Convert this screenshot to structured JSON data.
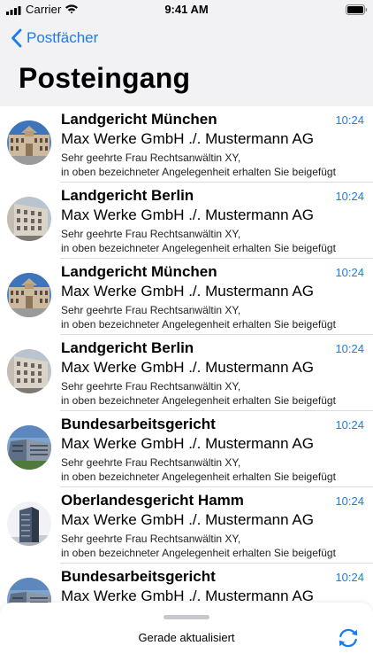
{
  "status_bar": {
    "carrier": "Carrier",
    "time": "9:41 AM"
  },
  "nav": {
    "back_label": "Postfächer",
    "title": "Posteingang"
  },
  "colors": {
    "accent": "#1a7cf0",
    "header_background": "#f2f2f4",
    "separator": "#dcdcde"
  },
  "mails": [
    {
      "sender": "Landgericht München",
      "time": "10:24",
      "subject": "Max Werke GmbH ./. Mustermann AG",
      "preview_line1": "Sehr geehrte Frau Rechtsanwältin XY,",
      "preview_line2": "in oben bezeichneter Angelegenheit erhalten Sie beigefügt",
      "avatar_icon": "palace-building-photo"
    },
    {
      "sender": "Landgericht Berlin",
      "time": "10:24",
      "subject": "Max Werke GmbH ./. Mustermann AG",
      "preview_line1": "Sehr geehrte Frau Rechtsanwältin XY,",
      "preview_line2": "in oben bezeichneter Angelegenheit erhalten Sie beigefügt",
      "avatar_icon": "courthouse-facade-photo"
    },
    {
      "sender": "Landgericht München",
      "time": "10:24",
      "subject": "Max Werke GmbH ./. Mustermann AG",
      "preview_line1": "Sehr geehrte Frau Rechtsanwältin XY,",
      "preview_line2": "in oben bezeichneter Angelegenheit erhalten Sie beigefügt",
      "avatar_icon": "palace-building-photo"
    },
    {
      "sender": "Landgericht Berlin",
      "time": "10:24",
      "subject": "Max Werke GmbH ./. Mustermann AG",
      "preview_line1": "Sehr geehrte Frau Rechtsanwältin XY,",
      "preview_line2": "in oben bezeichneter Angelegenheit erhalten Sie beigefügt",
      "avatar_icon": "courthouse-facade-photo"
    },
    {
      "sender": "Bundesarbeitsgericht",
      "time": "10:24",
      "subject": "Max Werke GmbH ./. Mustermann AG",
      "preview_line1": "Sehr geehrte Frau Rechtsanwältin XY,",
      "preview_line2": "in oben bezeichneter Angelegenheit erhalten Sie beigefügt",
      "avatar_icon": "modern-building-photo"
    },
    {
      "sender": "Oberlandesgericht Hamm",
      "time": "10:24",
      "subject": "Max Werke GmbH ./. Mustermann AG",
      "preview_line1": "Sehr geehrte Frau Rechtsanwältin XY,",
      "preview_line2": "in oben bezeichneter Angelegenheit erhalten Sie beigefügt",
      "avatar_icon": "tower-building-photo"
    },
    {
      "sender": "Bundesarbeitsgericht",
      "time": "10:24",
      "subject": "Max Werke GmbH ./. Mustermann AG",
      "preview_line1": "",
      "preview_line2": "",
      "avatar_icon": "modern-building-photo"
    }
  ],
  "footer": {
    "status_text": "Gerade aktualisiert",
    "refresh_icon": "refresh-icon"
  }
}
